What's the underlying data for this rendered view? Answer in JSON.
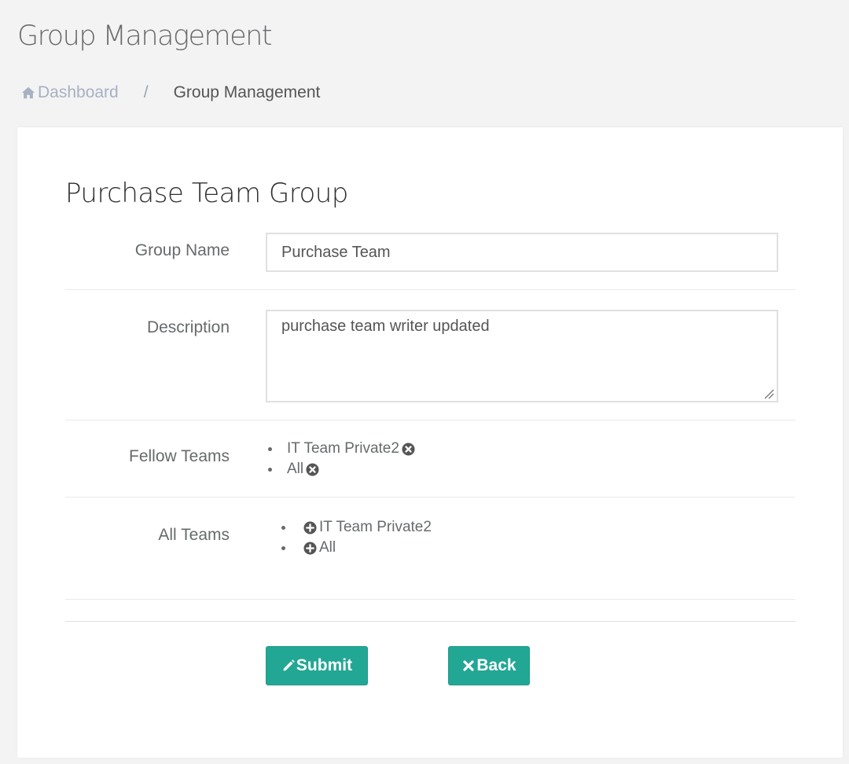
{
  "header": {
    "title": "Group Management"
  },
  "breadcrumb": {
    "home_label": "Dashboard",
    "separator": "/",
    "current": "Group Management"
  },
  "form": {
    "title": "Purchase Team Group",
    "group_name": {
      "label": "Group Name",
      "value": "Purchase Team"
    },
    "description": {
      "label": "Description",
      "value": "purchase team writer updated"
    },
    "fellow_teams": {
      "label": "Fellow Teams",
      "items": [
        {
          "name": "IT Team Private2",
          "icon": "remove-circle-icon"
        },
        {
          "name": "All",
          "icon": "remove-circle-icon"
        }
      ]
    },
    "all_teams": {
      "label": "All Teams",
      "items": [
        {
          "name": "IT Team Private2",
          "icon": "add-circle-icon"
        },
        {
          "name": "All",
          "icon": "add-circle-icon"
        }
      ]
    },
    "buttons": {
      "submit_label": "Submit",
      "back_label": "Back"
    }
  },
  "colors": {
    "accent": "#23a795",
    "breadcrumb_link": "#a7b1c2",
    "text": "#676a6c"
  }
}
